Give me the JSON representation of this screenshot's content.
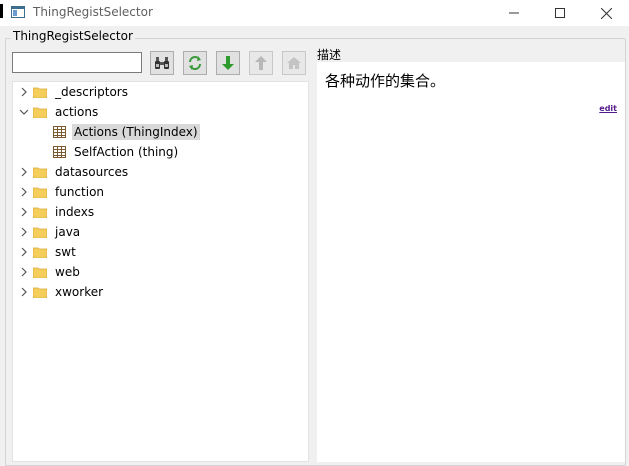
{
  "window": {
    "title": "ThingRegistSelector"
  },
  "group": {
    "label": "ThingRegistSelector"
  },
  "search": {
    "value": "",
    "placeholder": ""
  },
  "toolbar": {
    "buttons": [
      {
        "icon": "binoculars-icon",
        "enabled": true
      },
      {
        "icon": "refresh-icon",
        "enabled": true
      },
      {
        "icon": "arrow-down-icon",
        "enabled": true
      },
      {
        "icon": "arrow-up-icon",
        "enabled": false
      },
      {
        "icon": "home-icon",
        "enabled": false
      }
    ]
  },
  "tree": {
    "items": [
      {
        "label": "_descriptors",
        "type": "folder",
        "expanded": false
      },
      {
        "label": "actions",
        "type": "folder",
        "expanded": true,
        "children": [
          {
            "label": "Actions (ThingIndex)",
            "type": "table",
            "selected": true
          },
          {
            "label": "SelfAction (thing)",
            "type": "table",
            "selected": false
          }
        ]
      },
      {
        "label": "datasources",
        "type": "folder",
        "expanded": false
      },
      {
        "label": "function",
        "type": "folder",
        "expanded": false
      },
      {
        "label": "indexs",
        "type": "folder",
        "expanded": false
      },
      {
        "label": "java",
        "type": "folder",
        "expanded": false
      },
      {
        "label": "swt",
        "type": "folder",
        "expanded": false
      },
      {
        "label": "web",
        "type": "folder",
        "expanded": false
      },
      {
        "label": "xworker",
        "type": "folder",
        "expanded": false
      }
    ]
  },
  "description": {
    "title": "描述",
    "text": "各种动作的集合。",
    "edit_label": "edit"
  },
  "colors": {
    "folder": "#f5cd5b",
    "selection": "#d9d9d9",
    "link": "#551a8b"
  }
}
